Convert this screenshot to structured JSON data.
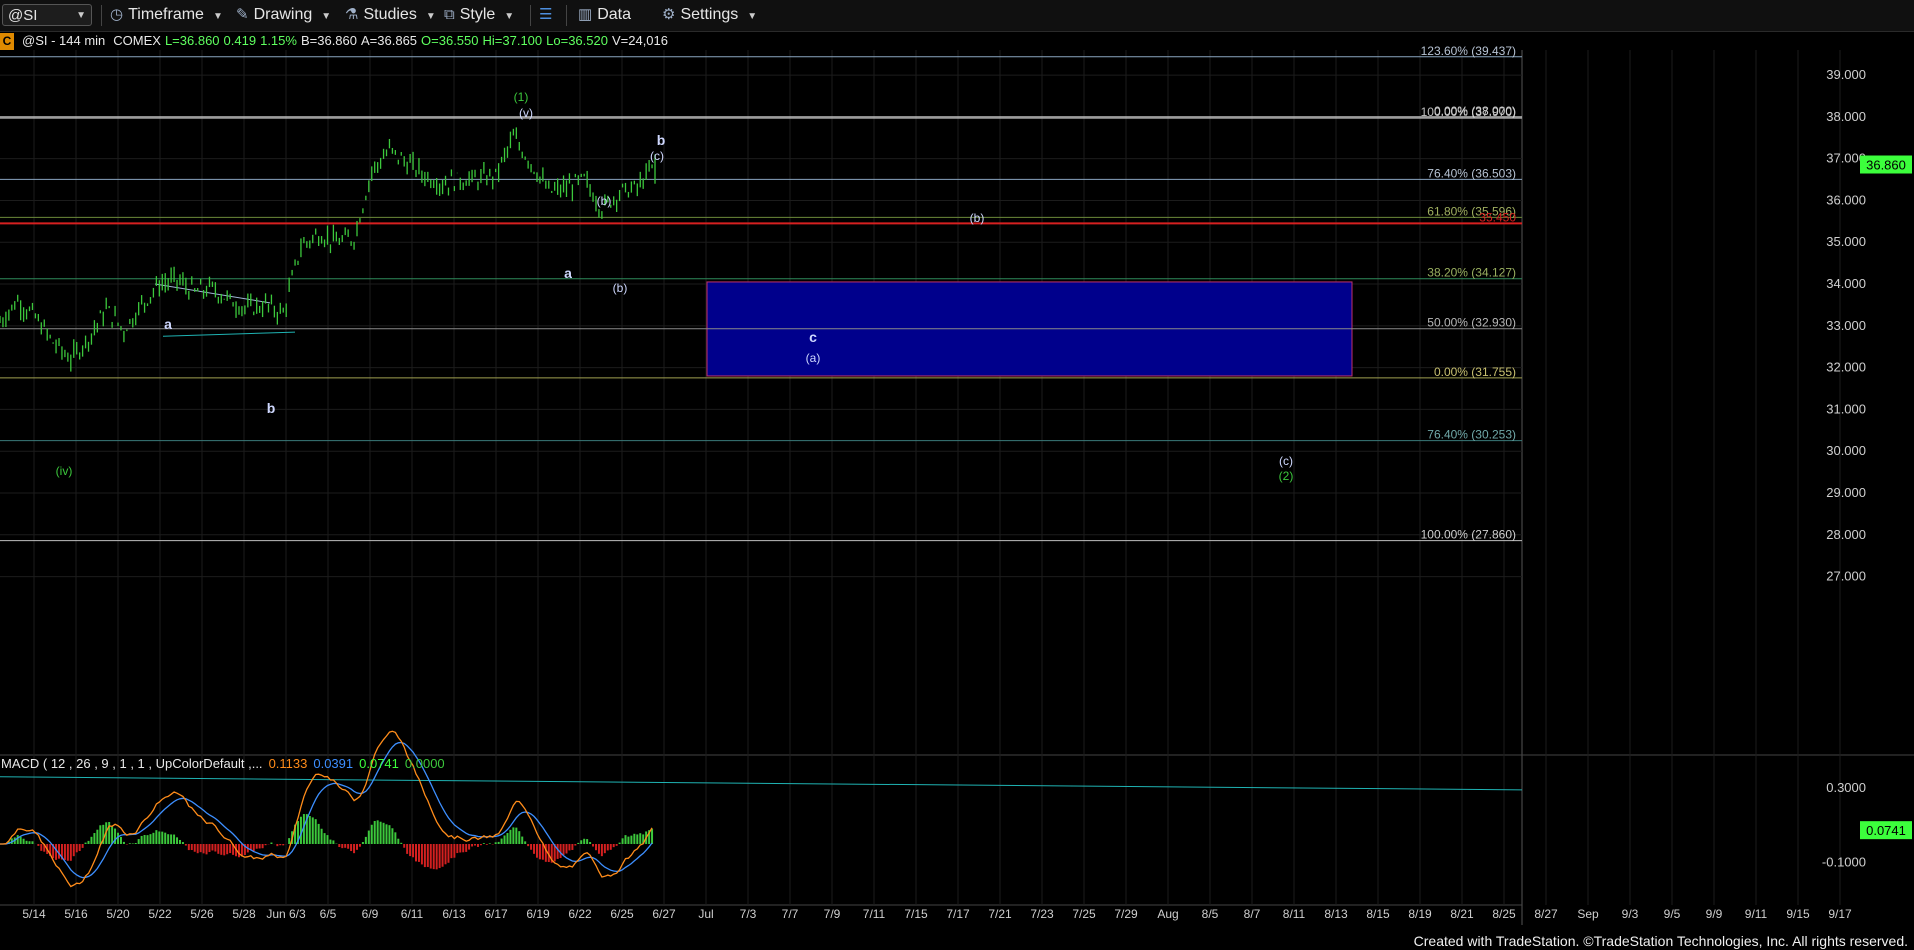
{
  "toolbar": {
    "symbol": "@SI",
    "timeframe": "Timeframe",
    "drawing": "Drawing",
    "studies": "Studies",
    "style": "Style",
    "data": "Data",
    "settings": "Settings"
  },
  "header": {
    "badge": "C",
    "symbol_info": "@SI - 144 min",
    "exchange": "COMEX",
    "last": "L=36.860",
    "change": "0.419",
    "change_pct": "1.15%",
    "bid": "B=36.860",
    "ask": "A=36.865",
    "open": "O=36.550",
    "high": "Hi=37.100",
    "low": "Lo=36.520",
    "volume": "V=24,016"
  },
  "macd_header": {
    "label": "MACD ( 12 , 26 , 9 , 1 , 1 , UpColorDefault ,...",
    "v1": "0.1133",
    "v2": "0.0391",
    "v3": "0.0741",
    "v4": "0.0000"
  },
  "footer": "Created with TradeStation. ©TradeStation Technologies, Inc. All rights reserved.",
  "colors": {
    "up": "#3cc83c",
    "macd_line": "#ff8c1a",
    "signal_line": "#3d8fff",
    "hist_pos": "#3cc83c",
    "hist_neg": "#d42020",
    "target_box": "#00008c",
    "last_price_tag": "#3cff3c",
    "trendline": "#1fb3b3"
  },
  "chart_data": {
    "type": "candlestick",
    "ylim": [
      26.2,
      39.6
    ],
    "y_ticks": [
      "39.000",
      "38.000",
      "37.000",
      "36.000",
      "35.000",
      "34.000",
      "33.000",
      "32.000",
      "31.000",
      "30.000",
      "29.000",
      "28.000",
      "27.000"
    ],
    "last_price": "36.860",
    "x_ticks": [
      "5/14",
      "5/16",
      "5/20",
      "5/22",
      "5/26",
      "5/28",
      "Jun 6/3",
      "6/5",
      "6/9",
      "6/11",
      "6/13",
      "6/17",
      "6/19",
      "6/22",
      "6/25",
      "6/27",
      "Jul",
      "7/3",
      "7/7",
      "7/9",
      "7/11",
      "7/15",
      "7/17",
      "7/21",
      "7/23",
      "7/25",
      "7/29",
      "Aug",
      "8/5",
      "8/7",
      "8/11",
      "8/13",
      "8/15",
      "8/19",
      "8/21",
      "8/25",
      "8/27",
      "Sep",
      "9/3",
      "9/5",
      "9/9",
      "9/11",
      "9/15",
      "9/17"
    ],
    "price_path": [
      [
        "5/12",
        33.1
      ],
      [
        "5/13",
        33.6
      ],
      [
        "5/14",
        33.2
      ],
      [
        "5/15",
        32.6
      ],
      [
        "5/16",
        32.2
      ],
      [
        "5/17",
        32.7
      ],
      [
        "5/19",
        33.4
      ],
      [
        "5/20",
        32.9
      ],
      [
        "5/21",
        33.5
      ],
      [
        "5/22",
        34.0
      ],
      [
        "5/23",
        34.1
      ],
      [
        "5/26",
        33.8
      ],
      [
        "5/27",
        33.9
      ],
      [
        "5/28",
        33.6
      ],
      [
        "5/29",
        33.4
      ],
      [
        "5/30",
        33.5
      ],
      [
        "6/1",
        33.3
      ],
      [
        "6/2",
        34.9
      ],
      [
        "6/3",
        35.2
      ],
      [
        "6/4",
        35.0
      ],
      [
        "6/5",
        35.1
      ],
      [
        "6/6",
        36.7
      ],
      [
        "6/9",
        37.2
      ],
      [
        "6/10",
        36.9
      ],
      [
        "6/11",
        36.6
      ],
      [
        "6/12",
        36.4
      ],
      [
        "6/13",
        36.5
      ],
      [
        "6/16",
        36.5
      ],
      [
        "6/17",
        36.6
      ],
      [
        "6/18",
        37.5
      ],
      [
        "6/19",
        36.9
      ],
      [
        "6/20",
        36.2
      ],
      [
        "6/22",
        36.3
      ],
      [
        "6/23",
        36.5
      ],
      [
        "6/24",
        35.8
      ],
      [
        "6/25",
        36.2
      ],
      [
        "6/26",
        36.3
      ],
      [
        "6/27",
        36.86
      ]
    ],
    "fib_levels": [
      {
        "label": "123.60% (39.437)",
        "value": 39.437
      },
      {
        "label": "100.00% (37.970)",
        "value": 37.97
      },
      {
        "label": "0.00% (38.000)",
        "value": 38.0
      },
      {
        "label": "76.40% (36.503)",
        "value": 36.503
      },
      {
        "label": "61.80% (35.596)",
        "value": 35.596
      },
      {
        "label": "35.450",
        "value": 35.45
      },
      {
        "label": "38.20% (34.127)",
        "value": 34.127
      },
      {
        "label": "50.00% (32.930)",
        "value": 32.93
      },
      {
        "label": "0.00% (31.755)",
        "value": 31.755
      },
      {
        "label": "76.40% (30.253)",
        "value": 30.253
      },
      {
        "label": "100.00% (27.860)",
        "value": 27.86
      }
    ],
    "target_box": {
      "high": 34.05,
      "low": 31.8
    },
    "wave_labels": [
      {
        "text": "(1)",
        "color": "#3cc83c"
      },
      {
        "text": "(v)",
        "color": "#cfd8ff"
      },
      {
        "text": "b",
        "color": "#cfd8ff"
      },
      {
        "text": "(c)",
        "color": "#cfd8ff"
      },
      {
        "text": "(b)",
        "color": "#cfd8ff"
      },
      {
        "text": "(b)",
        "color": "#cfd8ff"
      },
      {
        "text": "a",
        "color": "#cfd8ff"
      },
      {
        "text": "(b)",
        "color": "#cfd8ff"
      },
      {
        "text": "c",
        "color": "#cfd8ff"
      },
      {
        "text": "(a)",
        "color": "#cfd8ff"
      },
      {
        "text": "a",
        "color": "#cfd8ff"
      },
      {
        "text": "b",
        "color": "#cfd8ff"
      },
      {
        "text": "(iv)",
        "color": "#3cc83c"
      },
      {
        "text": "(c)",
        "color": "#cfd8ff"
      },
      {
        "text": "(2)",
        "color": "#3cc83c"
      }
    ],
    "macd": {
      "ylim": [
        -0.3,
        0.45
      ],
      "ticks": [
        "0.3000",
        "-0.1000"
      ],
      "last_value": "0.0741"
    }
  }
}
